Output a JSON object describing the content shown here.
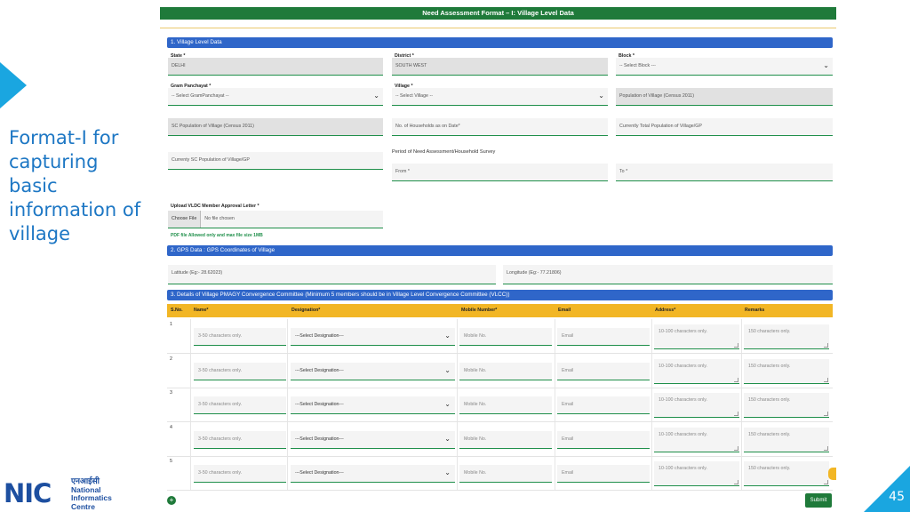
{
  "slide": {
    "caption": "Format-I  for capturing basic information of village",
    "page_number": "45",
    "logo": {
      "mark": "NIC",
      "hindi": "एनआईसी",
      "line1": "National",
      "line2": "Informatics",
      "line3": "Centre"
    },
    "accent_color": "#1aa6e0"
  },
  "form": {
    "title": "Need Assessment Format – I: Village Level Data",
    "section1": {
      "title": "1. Village Level Data",
      "state": {
        "label": "State *",
        "value": "DELHI"
      },
      "district": {
        "label": "District *",
        "value": "SOUTH WEST"
      },
      "block": {
        "label": "Block *",
        "value": "-- Select Block ---"
      },
      "gram_panchayat": {
        "label": "Gram Panchayat *",
        "value": "-- Select GramPanchayat --"
      },
      "village": {
        "label": "Village *",
        "value": "-- Select Village --"
      },
      "population": {
        "placeholder": "Population of Village (Census 2011)"
      },
      "sc_population": {
        "placeholder": "SC Population of Village (Census 2011)"
      },
      "households": {
        "placeholder": "No. of Households as on Date*"
      },
      "current_population": {
        "placeholder": "Currently Total Population of Village/GP"
      },
      "current_sc_population": {
        "placeholder": "Currenty SC Population of Village/GP"
      },
      "period_label": "Period of Need Assessment/Household Survey",
      "from": {
        "placeholder": "From *"
      },
      "to": {
        "placeholder": "To *"
      },
      "upload": {
        "label": "Upload VLDC Member Approval Letter *",
        "button": "Choose File",
        "status": "No file chosen",
        "note": "PDF file Allowed only and max file size 1MB"
      }
    },
    "section2": {
      "title": "2. GPS Data : GPS Coordinates of Village",
      "latitude": {
        "placeholder": "Latitude (Eg:- 28.62023)"
      },
      "longitude": {
        "placeholder": "Longitude (Eg:- 77.21806)"
      }
    },
    "section3": {
      "title": "3. Details of Village PMAGY Convergence Committee (Minimum 5 members should be in Village Level Convergence Committee (VLCC))",
      "columns": [
        "S.No.",
        "Name*",
        "Designation*",
        "Mobile Number*",
        "Email",
        "Address*",
        "Remarks"
      ],
      "rows": [
        {
          "sno": "1",
          "name": "3-50 characters only.",
          "designation": "---Select Designation---",
          "mobile": "Mobile No.",
          "email": "Email",
          "address": "10-100 characters only.",
          "remarks": "150 characters only."
        },
        {
          "sno": "2",
          "name": "3-50 characters only.",
          "designation": "---Select Designation---",
          "mobile": "Mobile No.",
          "email": "Email",
          "address": "10-100 characters only.",
          "remarks": "150 characters only."
        },
        {
          "sno": "3",
          "name": "3-50 characters only.",
          "designation": "---Select Designation---",
          "mobile": "Mobile No.",
          "email": "Email",
          "address": "10-100 characters only.",
          "remarks": "150 characters only."
        },
        {
          "sno": "4",
          "name": "3-50 characters only.",
          "designation": "---Select Designation---",
          "mobile": "Mobile No.",
          "email": "Email",
          "address": "10-100 characters only.",
          "remarks": "150 characters only."
        },
        {
          "sno": "5",
          "name": "3-50 characters only.",
          "designation": "---Select Designation---",
          "mobile": "Mobile No.",
          "email": "Email",
          "address": "10-100 characters only.",
          "remarks": "150 characters only."
        }
      ]
    },
    "add_label": "+",
    "submit_label": "Submit",
    "colors": {
      "header": "#1f7a3a",
      "section": "#2f66c9",
      "table_head": "#f2b625"
    }
  }
}
